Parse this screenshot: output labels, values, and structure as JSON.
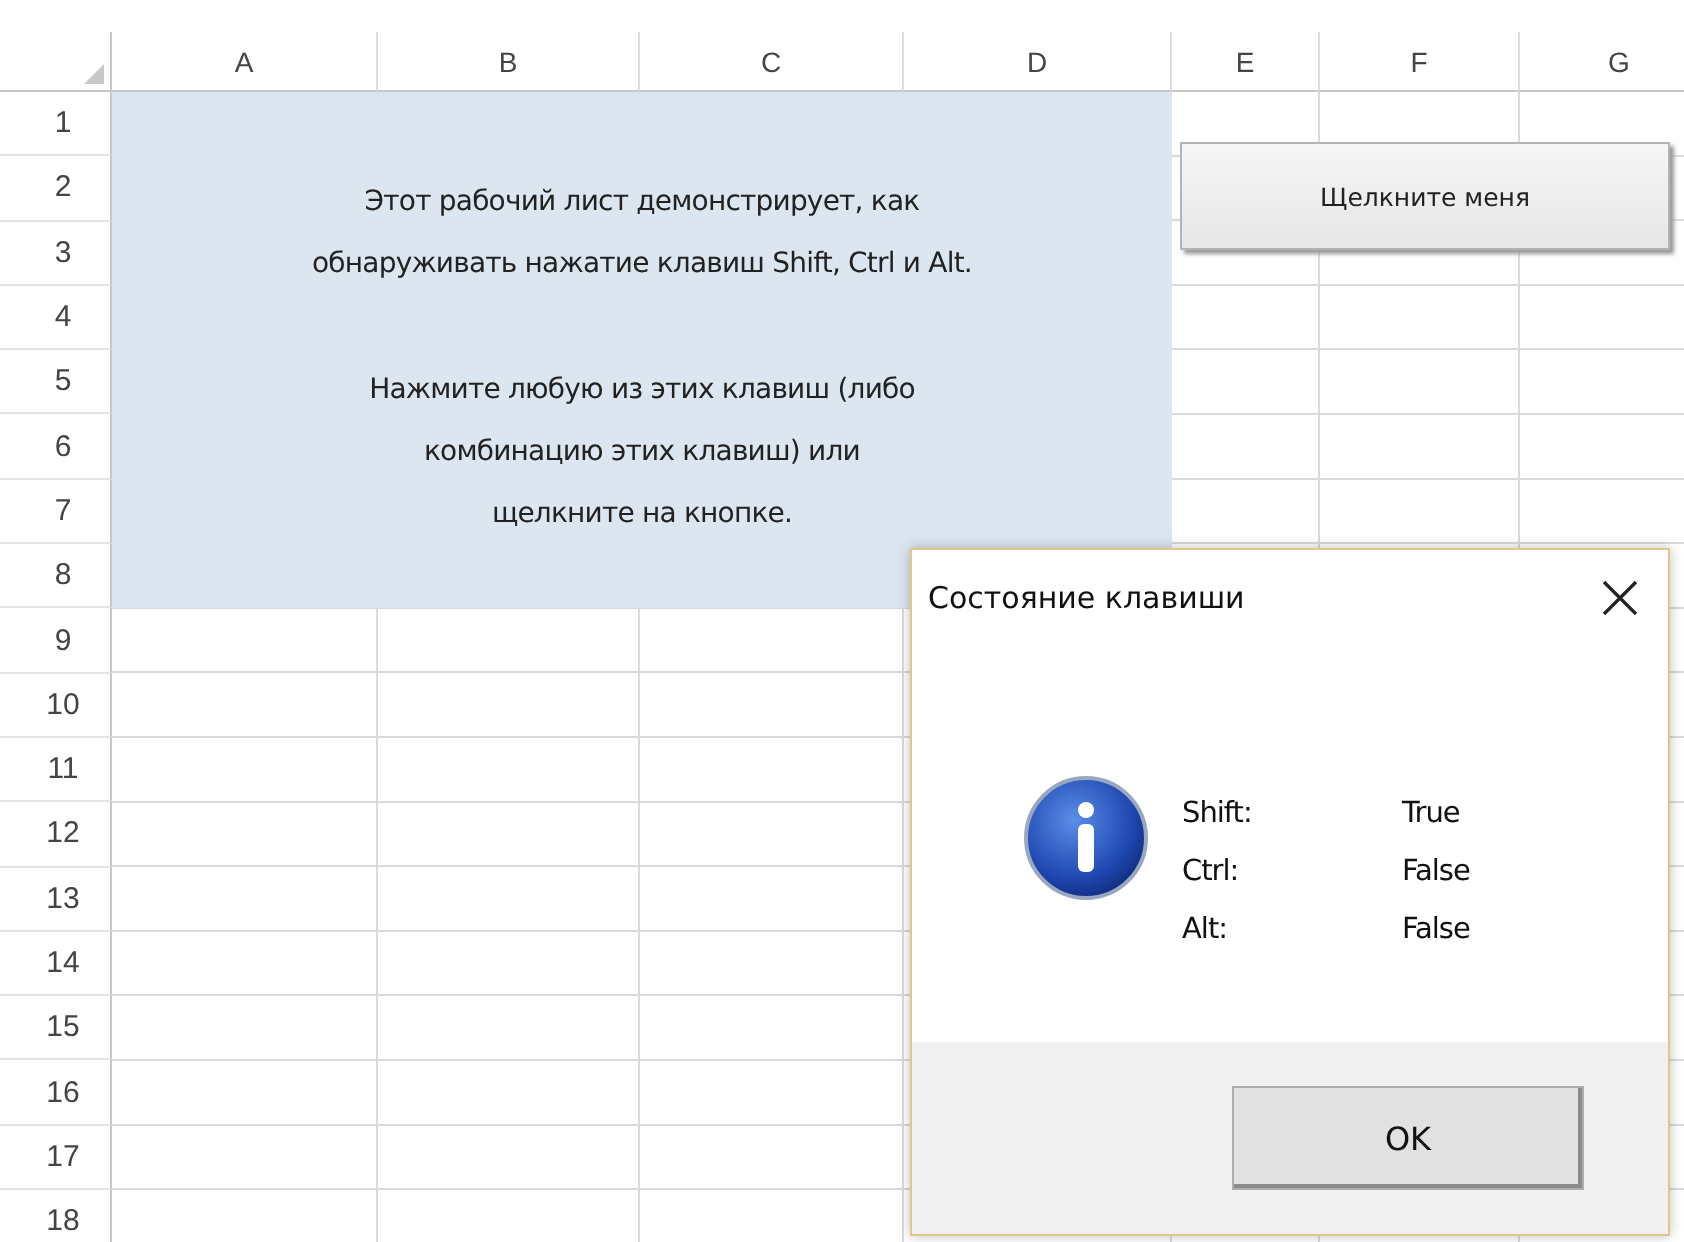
{
  "sheet": {
    "columns": [
      "A",
      "B",
      "C",
      "D",
      "E",
      "F",
      "G"
    ],
    "rows": [
      "1",
      "2",
      "3",
      "4",
      "5",
      "6",
      "7",
      "8",
      "9",
      "10",
      "11",
      "12",
      "13",
      "14",
      "15",
      "16",
      "17",
      "18"
    ]
  },
  "note": {
    "paragraphs": [
      "Этот рабочий лист демонстрирует, как\nобнаруживать нажатие клавиш Shift, Ctrl и Alt.",
      "Нажмите любую из этих клавиш (либо\nкомбинацию этих клавиш) или\nщелкните на кнопке."
    ]
  },
  "sheet_button": {
    "label": "Щелкните меня"
  },
  "dialog": {
    "title": "Состояние клавиши",
    "fields": [
      {
        "label": "Shift:",
        "value": "True"
      },
      {
        "label": "Ctrl:",
        "value": "False"
      },
      {
        "label": "Alt:",
        "value": "False"
      }
    ],
    "ok_button": "OK"
  }
}
